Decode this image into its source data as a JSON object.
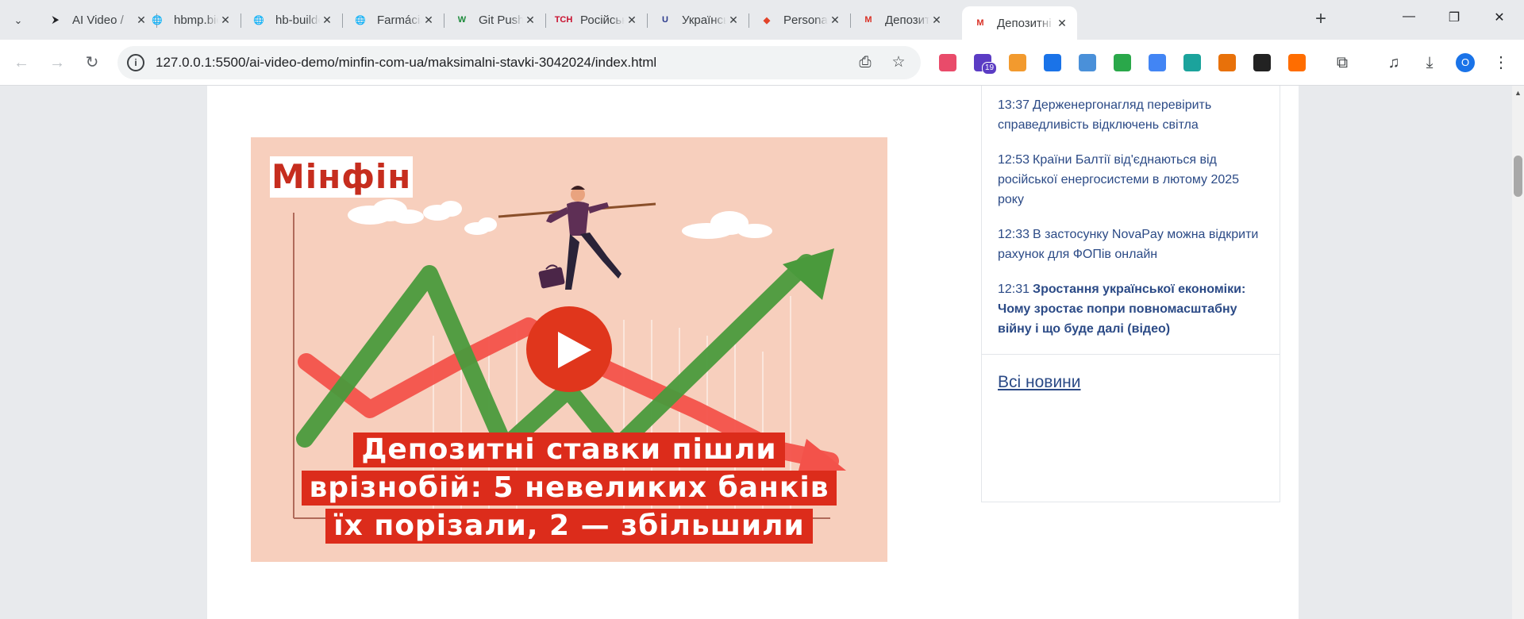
{
  "browser": {
    "tabs": [
      {
        "title": "AI Video /",
        "icon": "app-icon",
        "fav_color": "#202124",
        "fav_text": "⮞",
        "active": false
      },
      {
        "title": "hbmp.bidn",
        "icon": "globe-icon",
        "fav_color": "#5f6368",
        "fav_text": "🌐",
        "active": false
      },
      {
        "title": "hb-builder",
        "icon": "globe-icon",
        "fav_color": "#5f6368",
        "fav_text": "🌐",
        "active": false
      },
      {
        "title": "Farmácias",
        "icon": "globe-icon",
        "fav_color": "#5f6368",
        "fav_text": "🌐",
        "active": false
      },
      {
        "title": "Git Push to",
        "icon": "w-icon",
        "fav_color": "#1b8a3a",
        "fav_text": "W",
        "active": false
      },
      {
        "title": "Російські",
        "icon": "tsn-icon",
        "fav_color": "#c8102e",
        "fav_text": "ТСН",
        "active": false
      },
      {
        "title": "Українські",
        "icon": "u-icon",
        "fav_color": "#2b3a8c",
        "fav_text": "U",
        "active": false
      },
      {
        "title": "Personal A",
        "icon": "gitlab-icon",
        "fav_color": "#e24329",
        "fav_text": "◆",
        "active": false
      },
      {
        "title": "Депозитні",
        "icon": "minfin-icon",
        "fav_color": "#d93025",
        "fav_text": "M",
        "active": false
      },
      {
        "title": "Депозитні",
        "icon": "minfin-icon",
        "fav_color": "#d93025",
        "fav_text": "M",
        "active": true
      }
    ],
    "new_tab": "+",
    "controls": {
      "minimize": "—",
      "restore": "❐",
      "close": "✕"
    },
    "nav": {
      "back": "←",
      "forward": "→",
      "reload": "↻"
    },
    "url": "127.0.0.1:5500/ai-video-demo/minfin-com-ua/maksimalni-stavki-3042024/index.html",
    "badge_count": "19",
    "profile_initial": "O",
    "extensions": [
      {
        "name": "ext-pink-icon",
        "color": "#e94b6a"
      },
      {
        "name": "ext-purple-badge-icon",
        "color": "#5b3cc4"
      },
      {
        "name": "ext-orange-icon",
        "color": "#f29a2e"
      },
      {
        "name": "ext-blue-dollar-icon",
        "color": "#1a73e8"
      },
      {
        "name": "ext-diamond-icon",
        "color": "#4a90d9"
      },
      {
        "name": "ext-green-icon",
        "color": "#2aa84a"
      },
      {
        "name": "ext-translate-icon",
        "color": "#4285f4"
      },
      {
        "name": "ext-teal-icon",
        "color": "#1ba39c"
      },
      {
        "name": "ext-chess-icon",
        "color": "#e8710a"
      },
      {
        "name": "ext-react-icon",
        "color": "#222222"
      },
      {
        "name": "ext-fire-icon",
        "color": "#ff6d00"
      }
    ]
  },
  "page": {
    "hero": {
      "logo": "Мінфін",
      "title_lines": [
        "Депозитні ставки пішли",
        "врізнобій: 5 невеликих банків",
        "їх порізали, 2 — збільшили"
      ],
      "play_label": "play"
    },
    "news": {
      "items": [
        {
          "time": "13:37",
          "text": "Держенергонагляд перевірить справедливість відключень світла",
          "bold": false
        },
        {
          "time": "12:53",
          "text": "Країни Балтії від'єднаються від російської енергосистеми в лютому 2025 року",
          "bold": false
        },
        {
          "time": "12:33",
          "text": "В застосунку NovaPay можна відкрити рахунок для ФОПів онлайн",
          "bold": false
        },
        {
          "time": "12:31",
          "text": "Зростання української економіки: Чому зростає попри повномасштабну війну і що буде далі (відео)",
          "bold": true
        }
      ],
      "all_news": "Всі новини"
    }
  }
}
